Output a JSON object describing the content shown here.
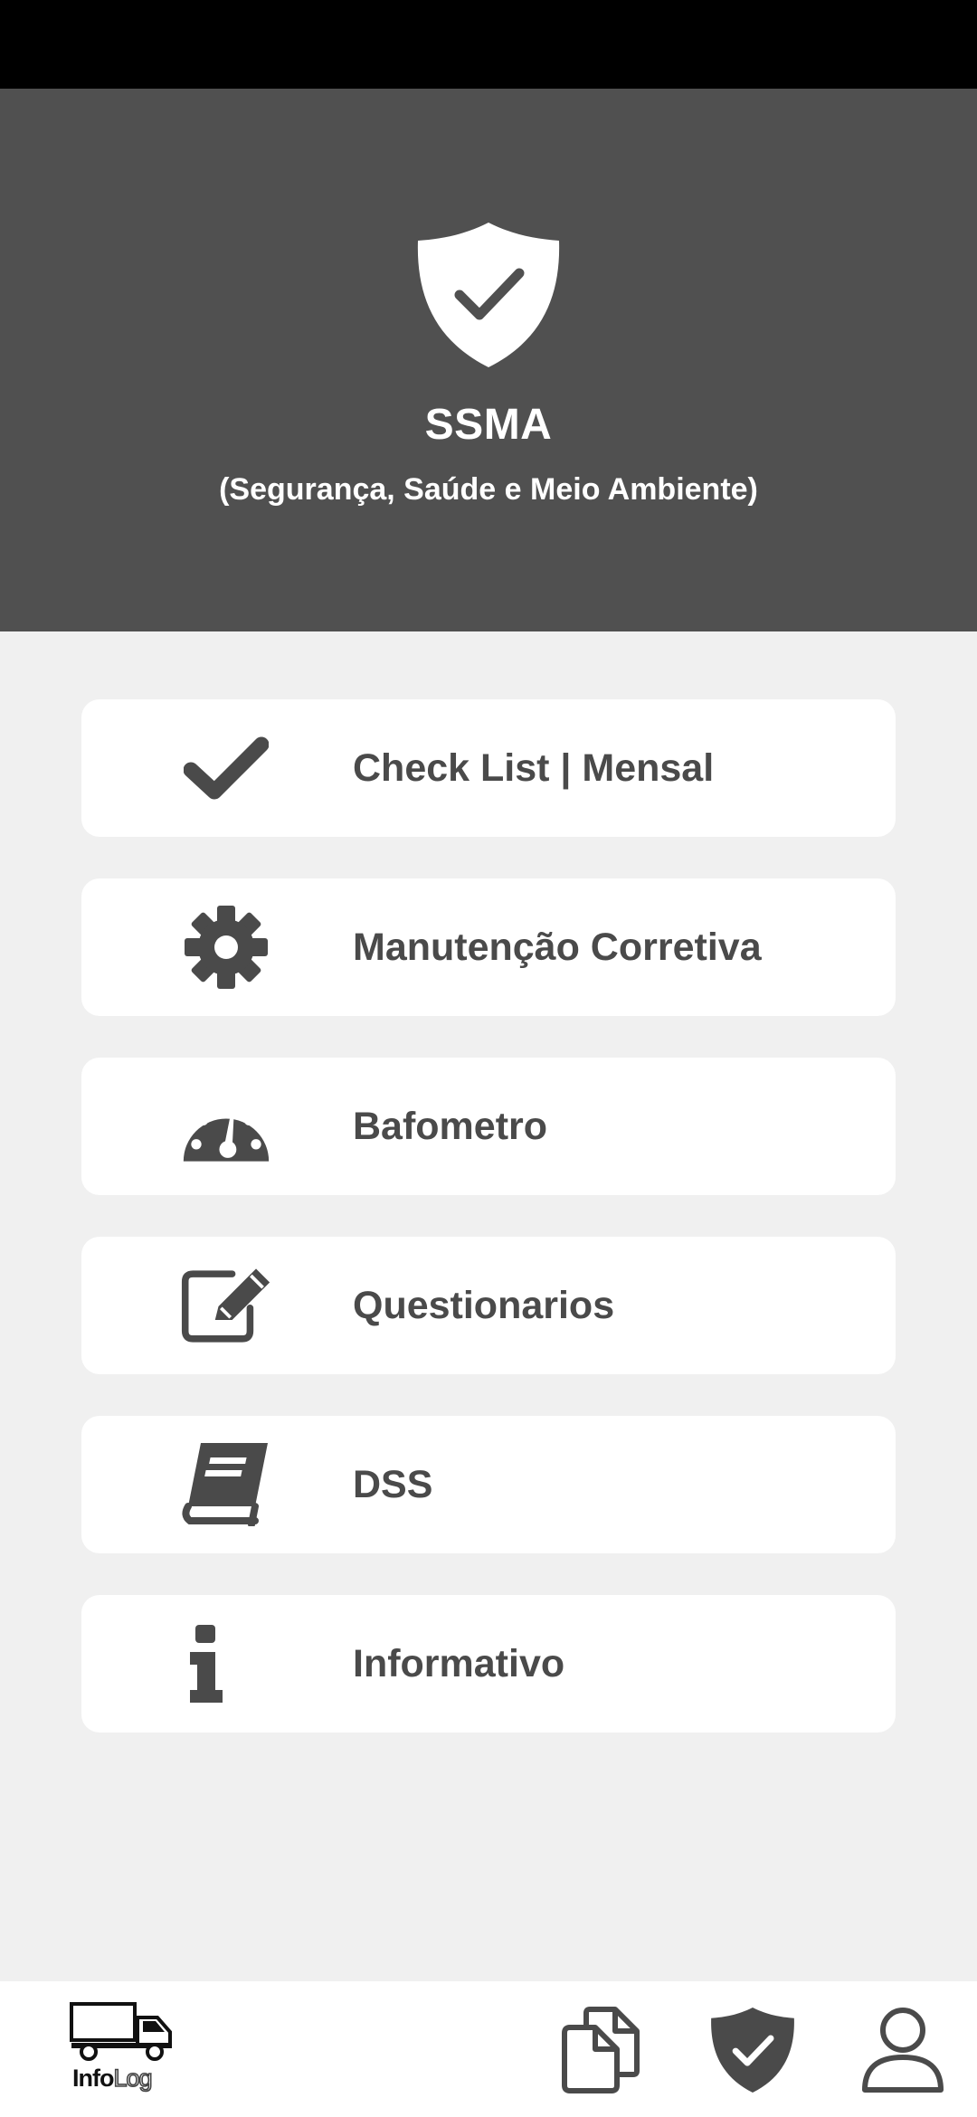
{
  "header": {
    "title": "SSMA",
    "subtitle": "(Segurança, Saúde e Meio Ambiente)",
    "icon": "shield-check-icon"
  },
  "menu": {
    "items": [
      {
        "label": "Check List | Mensal",
        "icon": "checkmark-icon"
      },
      {
        "label": "Manutenção Corretiva",
        "icon": "gear-icon"
      },
      {
        "label": "Bafometro",
        "icon": "gauge-icon"
      },
      {
        "label": "Questionarios",
        "icon": "edit-icon"
      },
      {
        "label": "DSS",
        "icon": "book-icon"
      },
      {
        "label": "Informativo",
        "icon": "info-icon"
      }
    ]
  },
  "bottom_nav": {
    "logo": {
      "part1": "Info",
      "part2": "Log",
      "icon": "truck-icon"
    },
    "items": [
      {
        "icon": "documents-icon"
      },
      {
        "icon": "shield-check-icon"
      },
      {
        "icon": "user-icon"
      }
    ]
  },
  "colors": {
    "header_bg": "#505050",
    "page_bg": "#f0f0f0",
    "icon": "#4a4a4a",
    "card": "#ffffff"
  }
}
